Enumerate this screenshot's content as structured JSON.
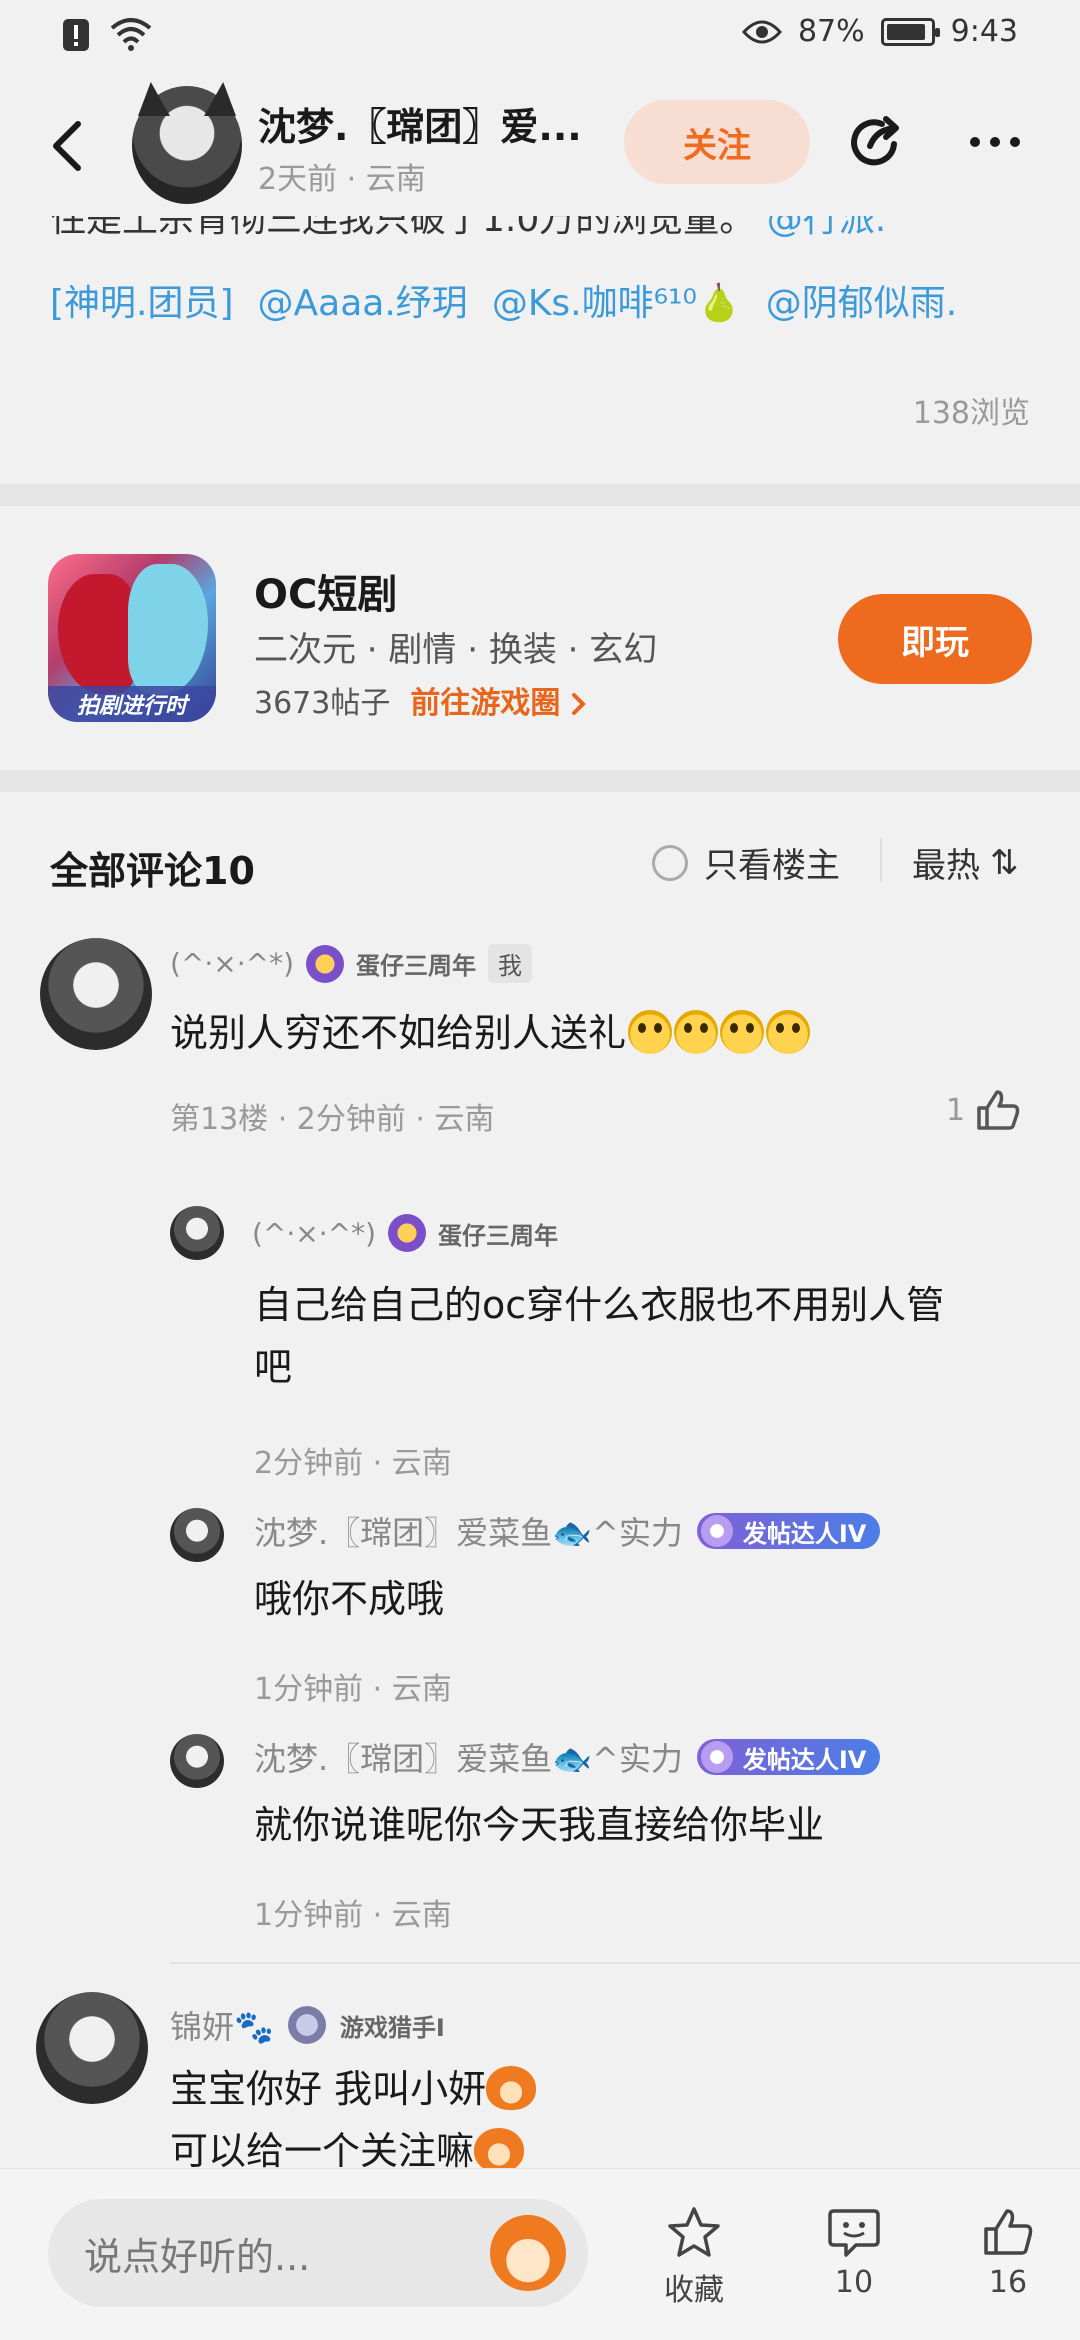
{
  "status": {
    "battery": "87%",
    "time": "9:43",
    "battery_level": 0.87
  },
  "header": {
    "author_name": "沈梦.〖瑺团〗爱...",
    "author_meta": "2天前 · 云南",
    "follow_label": "关注"
  },
  "post": {
    "cut_text": "住是土宗育彻三连我只破了1.0万的浏览量。",
    "cut_text_link": "@行派.",
    "mentions": [
      "[神明.团员]",
      "@Aaaa.纾玥",
      "@Ks.咖啡⁶¹⁰🍐",
      "@阴郁似雨."
    ],
    "views": "138浏览"
  },
  "game": {
    "title": "OC短剧",
    "tags": "二次元 · 剧情 · 换装 · 玄幻",
    "icon_tag": "拍剧进行时",
    "posts": "3673帖子",
    "link": "前往游戏圈",
    "play_label": "即玩"
  },
  "comments_header": {
    "title": "全部评论10",
    "only_op": "只看楼主",
    "sort": "最热",
    "sort_icon": "⇅"
  },
  "comments": [
    {
      "nick": "(^·×·^*)",
      "badge": "蛋仔三周年",
      "me_tag": "我",
      "text": "说别人穷还不如给别人送礼",
      "meta": "第13楼 · 2分钟前 · 云南",
      "likes": "1"
    },
    {
      "nick": "(^·×·^*)",
      "badge": "蛋仔三周年",
      "text_line1": "自己给自己的oc穿什么衣服也不用别人管",
      "text_line2": "吧",
      "meta": "2分钟前 · 云南"
    },
    {
      "nick": "沈梦.〖瑺团〗爱菜鱼🐟^实力",
      "badge": "发帖达人IV",
      "text": "哦你不成哦",
      "meta": "1分钟前 · 云南"
    },
    {
      "nick": "沈梦.〖瑺团〗爱菜鱼🐟^实力",
      "badge": "发帖达人IV",
      "text": "就你说谁呢你今天我直接给你毕业",
      "meta": "1分钟前 · 云南"
    },
    {
      "nick": "锦妍🐾",
      "badge": "游戏猎手I",
      "text_line1": "宝宝你好 我叫小妍",
      "text_line2": "可以给一个关注嘛"
    }
  ],
  "bottom": {
    "input_placeholder": "说点好听的...",
    "fav_label": "收藏",
    "comment_count": "10",
    "like_count": "16"
  },
  "colors": {
    "accent": "#ed6a1f",
    "link": "#3b9ad9",
    "background": "#f1f1f1"
  }
}
